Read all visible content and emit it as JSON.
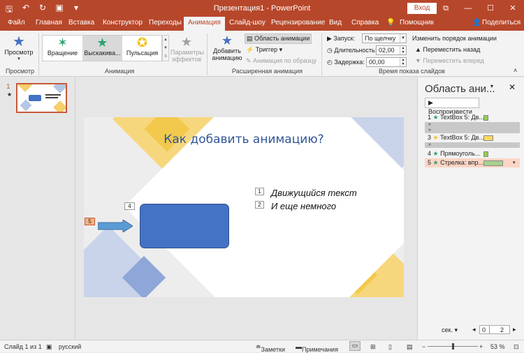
{
  "window": {
    "title": "Презентация1 - PowerPoint",
    "login": "Вход",
    "controls": [
      "⧉",
      "—",
      "☐",
      "✕"
    ]
  },
  "qat_icons": [
    "save-icon",
    "undo-icon",
    "redo-icon",
    "slideshow-icon",
    "customize-icon"
  ],
  "tabs": [
    "Файл",
    "Главная",
    "Вставка",
    "Конструктор",
    "Переходы",
    "Анимация",
    "Слайд-шоу",
    "Рецензирование",
    "Вид",
    "Справка",
    "Помощник",
    "Поделиться"
  ],
  "active_tab": "Анимация",
  "ribbon": {
    "preview": {
      "label": "Просмотр",
      "group": "Просмотр"
    },
    "gallery": [
      {
        "label": "Вращение",
        "color": "#2ea36e",
        "selected": false
      },
      {
        "label": "Выскакива...",
        "color": "#2ea36e",
        "selected": true
      },
      {
        "label": "Пульсация",
        "color": "#f2c318",
        "selected": false
      }
    ],
    "effect_params": [
      "Параметры",
      "эффектов"
    ],
    "animation_group": "Анимация",
    "add_animation": [
      "Добавить",
      "анимацию"
    ],
    "anim_pane_btn": "Область анимации",
    "trigger": "Триггер",
    "anim_painter": "Анимация по образцу",
    "adv_group": "Расширенная анимация",
    "start_label": "Запуск:",
    "start_value": "По щелчку",
    "duration_label": "Длительность:",
    "duration_value": "02,00",
    "delay_label": "Задержка:",
    "delay_value": "00,00",
    "reorder_title": "Изменить порядок анимации",
    "move_back": "Переместить назад",
    "move_forward": "Переместить вперед",
    "timing_group": "Время показа слайдов"
  },
  "thumbnail": {
    "number": "1",
    "star": "★"
  },
  "slide": {
    "title": "Как добавить анимацию?",
    "bullets": [
      {
        "num": "1",
        "text": "Движущийся текст"
      },
      {
        "num": "2",
        "text": "И еще немного"
      }
    ],
    "tag_rect": "4",
    "tag_arrow": "5"
  },
  "pane": {
    "title": "Область ани...",
    "play": "Воспроизвести",
    "items": [
      {
        "num": "1",
        "star": "★",
        "star_color": "#2ea36e",
        "label": "TextBox 5: Дв...",
        "bar_color": "#92d050",
        "selected": false
      },
      {
        "num": "3",
        "star": "★",
        "star_color": "#f2c318",
        "label": "TextBox 5: Дв...",
        "bar_color": "#ffd966",
        "selected": false
      },
      {
        "num": "4",
        "star": "★",
        "star_color": "#2ea36e",
        "label": "Прямоуголь...",
        "bar_color": "#92d050",
        "selected": false
      },
      {
        "num": "5",
        "star": "★",
        "star_color": "#2ea36e",
        "label": "Стрелка: впр...",
        "bar_color": "#a9d18e",
        "selected": true
      }
    ],
    "sec": "сек.",
    "scale_0": "0",
    "scale_2": "2"
  },
  "status": {
    "slide": "Слайд 1 из 1",
    "lang": "русский",
    "notes": "Заметки",
    "comments": "Примечания",
    "zoom": "53 %"
  },
  "colors": {
    "accent": "#b7472a",
    "slide_title": "#2f5597"
  }
}
